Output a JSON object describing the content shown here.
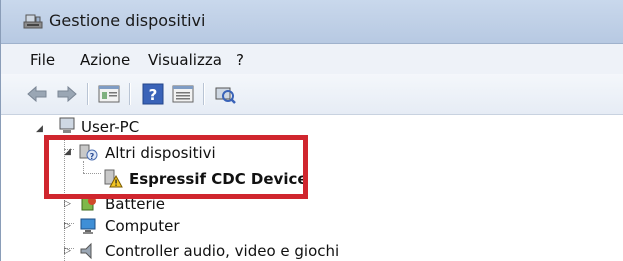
{
  "window": {
    "title": "Gestione dispositivi"
  },
  "menu": {
    "items": [
      "File",
      "Azione",
      "Visualizza",
      "?"
    ]
  },
  "toolbar": {
    "buttons": [
      "back-arrow-icon",
      "forward-arrow-icon",
      "properties-icon",
      "help-icon",
      "view-icon",
      "scan-hardware-icon"
    ]
  },
  "tree": {
    "root": "User-PC",
    "nodes": [
      {
        "label": "Altri dispositivi",
        "icon": "unknown-device-icon"
      },
      {
        "label": "Espressif CDC Device",
        "icon": "warning-device-icon"
      },
      {
        "label": "Batterie",
        "icon": "battery-icon"
      },
      {
        "label": "Computer",
        "icon": "computer-icon"
      },
      {
        "label": "Controller audio, video e giochi",
        "icon": "speaker-icon"
      }
    ]
  },
  "colors": {
    "highlight": "#d0262e",
    "titlebar": "#c9d8ec"
  }
}
